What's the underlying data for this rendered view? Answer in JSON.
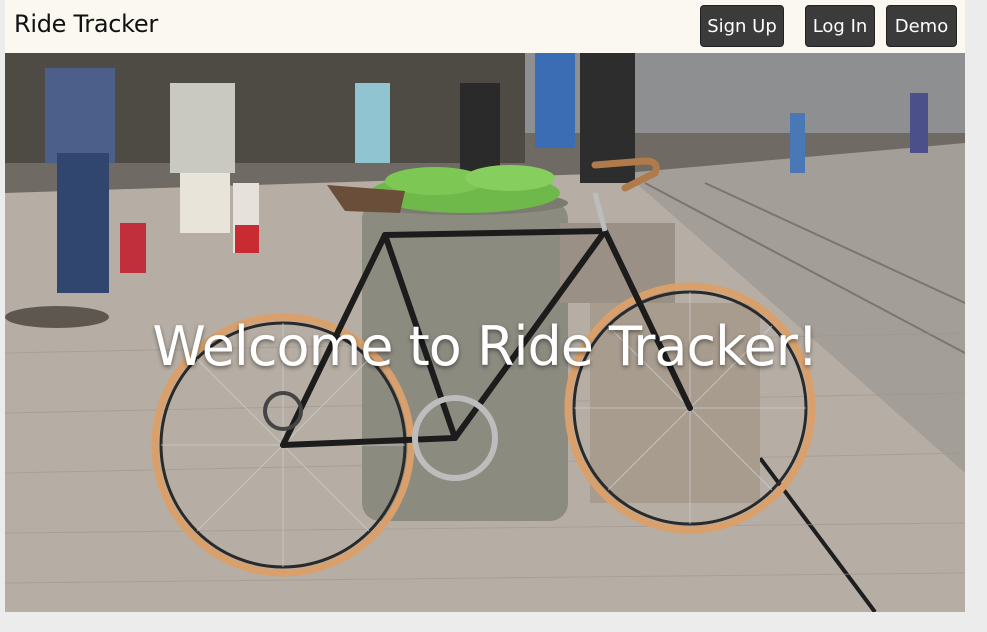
{
  "navbar": {
    "brand": "Ride Tracker",
    "buttons": {
      "signup": "Sign Up",
      "login": "Log In",
      "demo": "Demo"
    }
  },
  "hero": {
    "title": "Welcome to Ride Tracker!",
    "image": "bicycle-street-photo"
  },
  "colors": {
    "navbar_bg": "#fbf8f1",
    "button_bg": "#3b3b3b",
    "button_text": "#ffffff"
  }
}
